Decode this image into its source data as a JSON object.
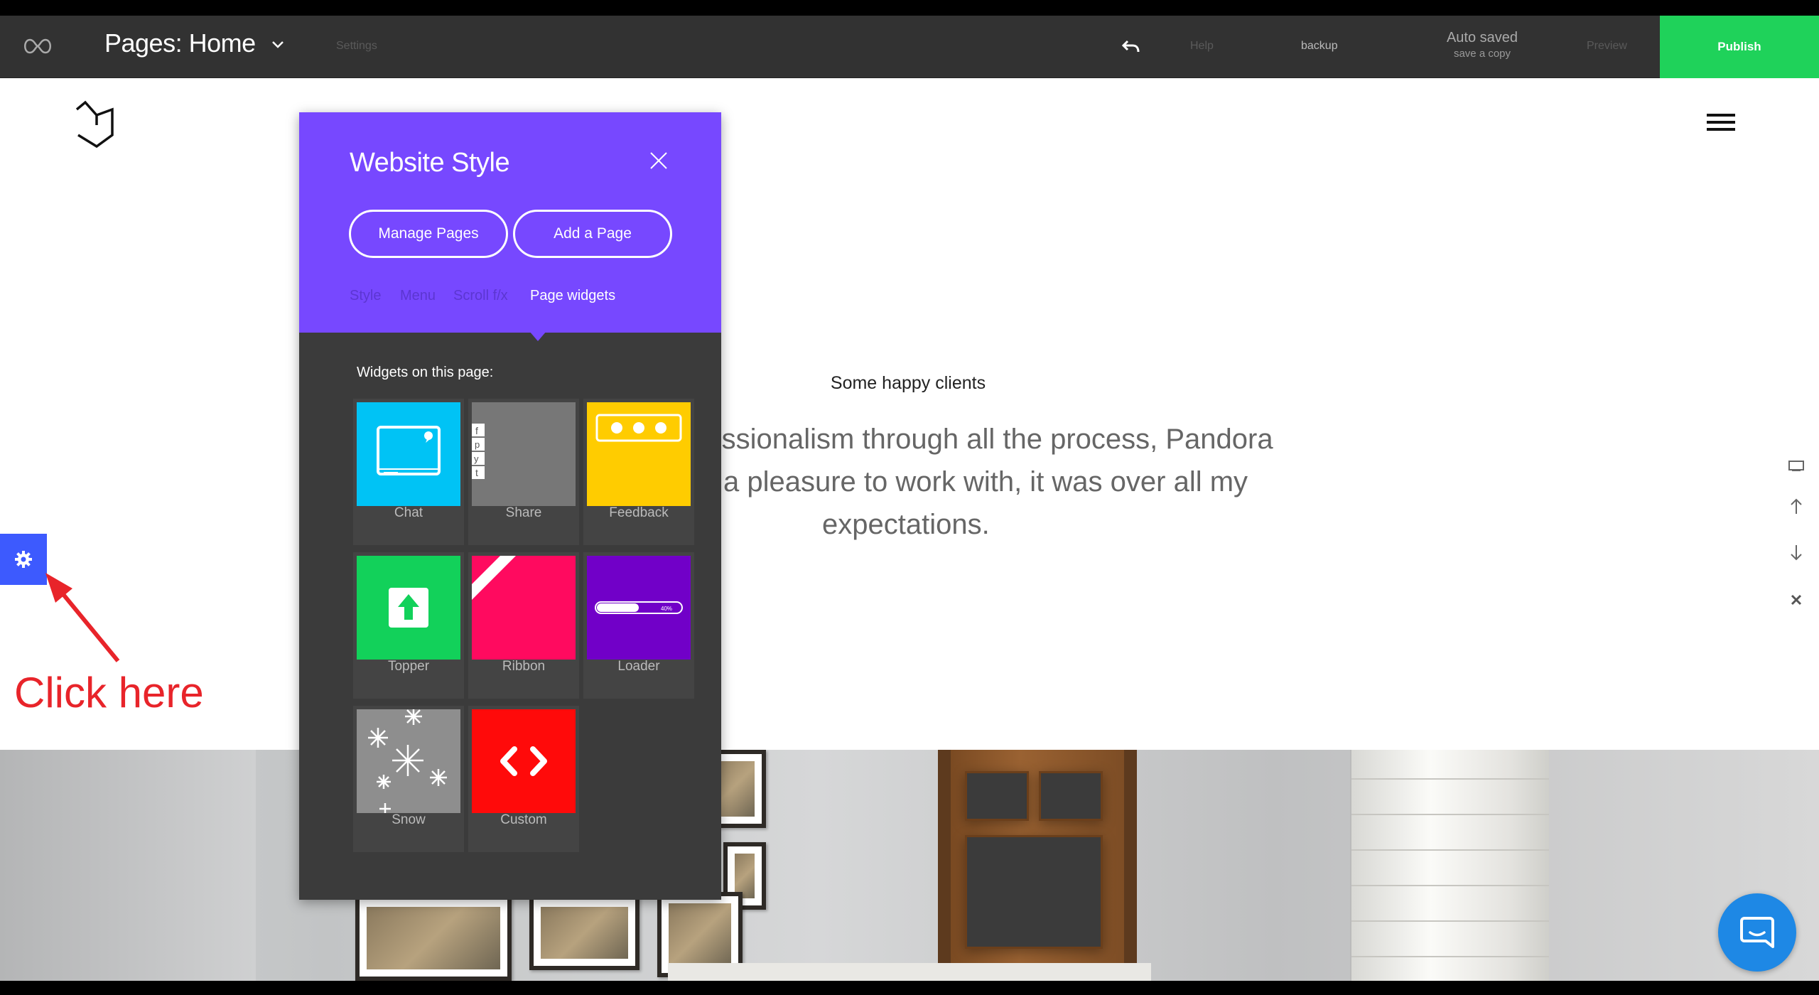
{
  "toolbar": {
    "pages_title": "Pages: Home",
    "settings": "Settings",
    "help": "Help",
    "backup": "backup",
    "autosaved": "Auto saved",
    "save_copy": "save a copy",
    "preview": "Preview",
    "publish": "Publish",
    "publish_color": "#1fd25a"
  },
  "site": {
    "happy_clients": "Some happy clients",
    "quote_line1": "ofessionalism through all the process, Pandora",
    "quote_line2": "a pleasure to work with, it was over all my",
    "quote_line3": "expectations."
  },
  "panel": {
    "title": "Website Style",
    "accent": "#7748ff",
    "manage_pages": "Manage Pages",
    "add_page": "Add a Page",
    "tabs": [
      {
        "label": "Style"
      },
      {
        "label": "Menu"
      },
      {
        "label": "Scroll f/x"
      },
      {
        "label": "Page widgets",
        "active": true
      }
    ],
    "widgets_label": "Widgets on this page:",
    "widgets": [
      {
        "label": "Chat",
        "color": "#00c3f5"
      },
      {
        "label": "Share",
        "color": "#777777"
      },
      {
        "label": "Feedback",
        "color": "#ffcc00"
      },
      {
        "label": "Topper",
        "color": "#12d15a"
      },
      {
        "label": "Ribbon",
        "color": "#ff0a5f"
      },
      {
        "label": "Loader",
        "color": "#7100c8",
        "loader_text": "40%",
        "progress": 0.5
      },
      {
        "label": "Snow",
        "color": "#8e8e8e"
      },
      {
        "label": "Custom",
        "color": "#ff0a0a"
      }
    ]
  },
  "annotation": {
    "click_here": "Click here",
    "color": "#e8242a"
  },
  "icons": {
    "logo": "infinity-icon",
    "chevron": "chevron-down-icon",
    "undo": "undo-icon",
    "gear": "gear-icon",
    "chat": "chat-bubble-icon"
  }
}
